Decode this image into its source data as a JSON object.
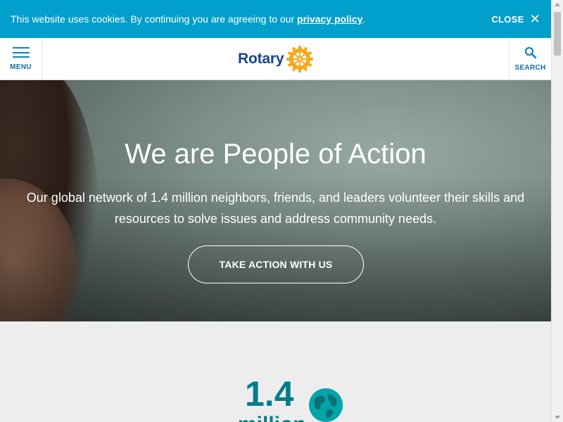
{
  "cookie_banner": {
    "message": "This website uses cookies. By continuing you are agreeing to our ",
    "link_text": "privacy policy",
    "message_end": ".",
    "close_label": "CLOSE",
    "close_icon": "close-icon"
  },
  "header": {
    "menu_label": "MENU",
    "logo_text": "Rotary",
    "search_label": "SEARCH"
  },
  "hero": {
    "title": "We are People of Action",
    "text": "Our global network of 1.4 million neighbors, friends, and leaders volunteer their skills and resources to solve issues and address community needs.",
    "cta_label": "TAKE ACTION WITH US"
  },
  "stats": {
    "number": "1.4",
    "unit": "million",
    "icon": "globe-icon"
  },
  "colors": {
    "banner": "#019fcb",
    "brand_blue": "#17458f",
    "brand_gold": "#f7a81b",
    "stat_teal": "#017d8a"
  }
}
